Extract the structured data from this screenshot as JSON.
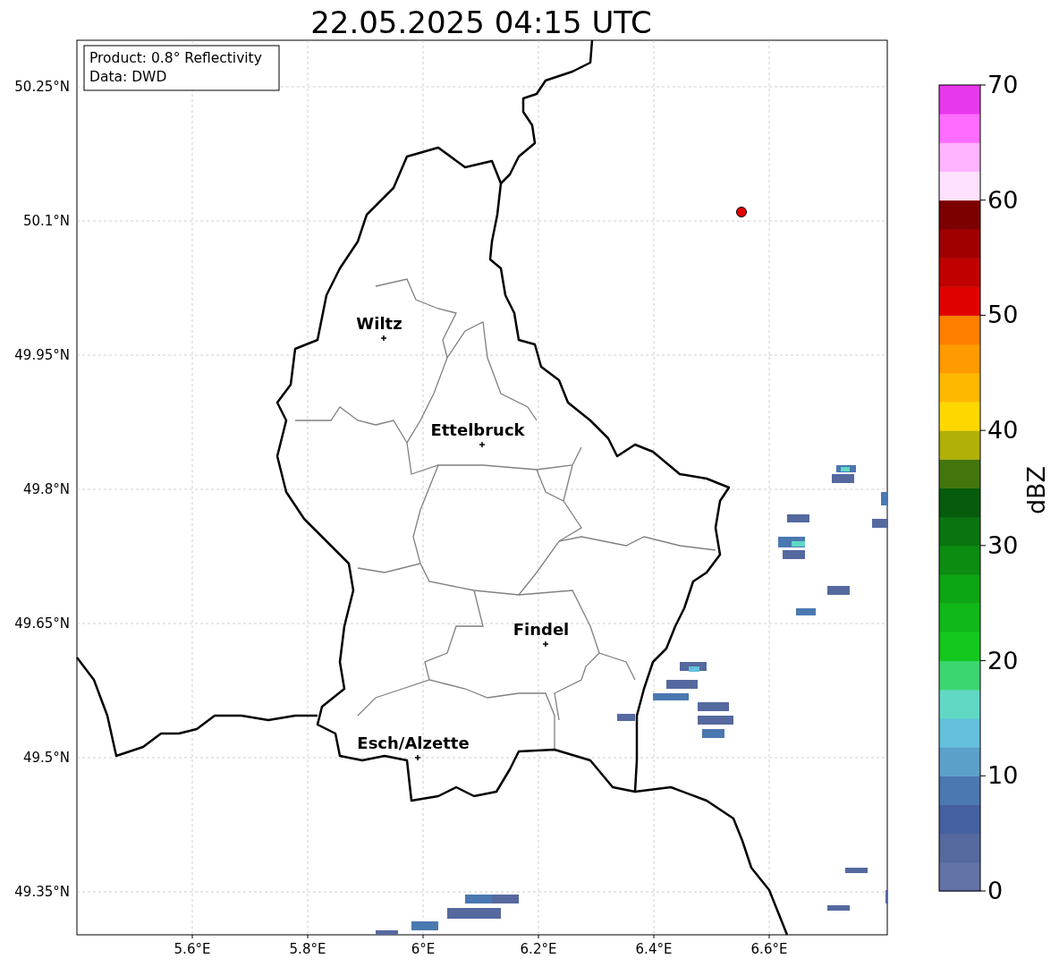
{
  "title": "22.05.2025 04:15 UTC",
  "info_box": [
    "Product: 0.8° Reflectivity",
    "Data: DWD"
  ],
  "x_ticks": [
    "5.6°E",
    "5.8°E",
    "6°E",
    "6.2°E",
    "6.4°E",
    "6.6°E"
  ],
  "y_ticks": [
    "50.25°N",
    "50.1°N",
    "49.95°N",
    "49.8°N",
    "49.65°N",
    "49.5°N",
    "49.35°N"
  ],
  "cities": [
    {
      "name": "Wiltz"
    },
    {
      "name": "Ettelbruck"
    },
    {
      "name": "Findel"
    },
    {
      "name": "Esch/Alzette"
    }
  ],
  "colorbar": {
    "label": "dBZ",
    "ticks": [
      "70",
      "60",
      "50",
      "40",
      "30",
      "20",
      "10",
      "0"
    ]
  }
}
